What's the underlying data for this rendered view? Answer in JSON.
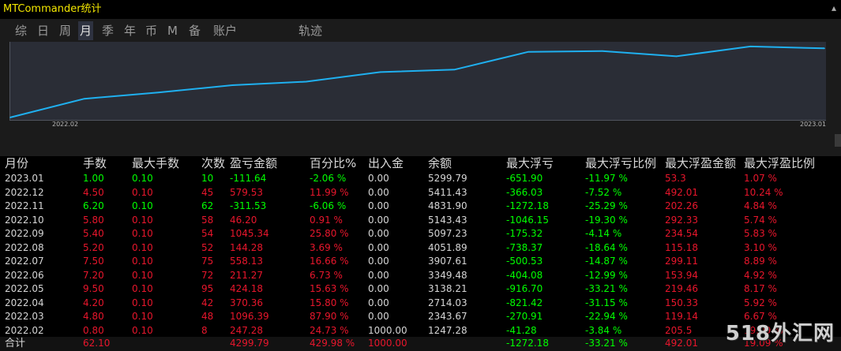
{
  "app": {
    "title": "MTCommander统计"
  },
  "tabs": [
    {
      "label": "综"
    },
    {
      "label": "日"
    },
    {
      "label": "周"
    },
    {
      "label": "月"
    },
    {
      "label": "季"
    },
    {
      "label": "年"
    },
    {
      "label": "币"
    },
    {
      "label": "M"
    },
    {
      "label": "备"
    },
    {
      "label": "账户"
    },
    {
      "label": "轨迹"
    }
  ],
  "active_tab": "月",
  "chart_data": {
    "type": "line",
    "x": [
      "2022.02",
      "2022.03",
      "2022.04",
      "2022.05",
      "2022.06",
      "2022.07",
      "2022.08",
      "2022.09",
      "2022.10",
      "2022.11",
      "2022.12",
      "2023.01"
    ],
    "series": [
      {
        "values": [
          1247.28,
          2343.67,
          2714.03,
          3138.21,
          3349.48,
          3907.61,
          4051.89,
          5097.23,
          5143.43,
          4831.9,
          5411.43,
          5299.79
        ]
      }
    ],
    "x_tick_labels": [
      "2022.02",
      "2023.01"
    ],
    "ylim": [
      1150,
      5500
    ],
    "line_color": "#1fb0f0",
    "grid": false
  },
  "table": {
    "headers": [
      "月份",
      "手数",
      "最大手数",
      "次数",
      "盈亏金额",
      "百分比%",
      "出入金",
      "余额",
      "最大浮亏",
      "最大浮亏比例",
      "最大浮盈金额",
      "最大浮盈比例"
    ],
    "rows": [
      {
        "month": "2023.01",
        "lots": "1.00",
        "max_lots": "0.10",
        "count": "10",
        "pnl": "-111.64",
        "pct": "-2.06 %",
        "io": "0.00",
        "balance": "5299.79",
        "max_dd": "-651.90",
        "max_dd_pct": "-11.97 %",
        "max_fp": "53.3",
        "max_fp_pct": "1.07 %",
        "sign": "g"
      },
      {
        "month": "2022.12",
        "lots": "4.50",
        "max_lots": "0.10",
        "count": "45",
        "pnl": "579.53",
        "pct": "11.99 %",
        "io": "0.00",
        "balance": "5411.43",
        "max_dd": "-366.03",
        "max_dd_pct": "-7.52 %",
        "max_fp": "492.01",
        "max_fp_pct": "10.24 %",
        "sign": "r"
      },
      {
        "month": "2022.11",
        "lots": "6.20",
        "max_lots": "0.10",
        "count": "62",
        "pnl": "-311.53",
        "pct": "-6.06 %",
        "io": "0.00",
        "balance": "4831.90",
        "max_dd": "-1272.18",
        "max_dd_pct": "-25.29 %",
        "max_fp": "202.26",
        "max_fp_pct": "4.84 %",
        "sign": "g"
      },
      {
        "month": "2022.10",
        "lots": "5.80",
        "max_lots": "0.10",
        "count": "58",
        "pnl": "46.20",
        "pct": "0.91 %",
        "io": "0.00",
        "balance": "5143.43",
        "max_dd": "-1046.15",
        "max_dd_pct": "-19.30 %",
        "max_fp": "292.33",
        "max_fp_pct": "5.74 %",
        "sign": "r"
      },
      {
        "month": "2022.09",
        "lots": "5.40",
        "max_lots": "0.10",
        "count": "54",
        "pnl": "1045.34",
        "pct": "25.80 %",
        "io": "0.00",
        "balance": "5097.23",
        "max_dd": "-175.32",
        "max_dd_pct": "-4.14 %",
        "max_fp": "234.54",
        "max_fp_pct": "5.83 %",
        "sign": "r"
      },
      {
        "month": "2022.08",
        "lots": "5.20",
        "max_lots": "0.10",
        "count": "52",
        "pnl": "144.28",
        "pct": "3.69 %",
        "io": "0.00",
        "balance": "4051.89",
        "max_dd": "-738.37",
        "max_dd_pct": "-18.64 %",
        "max_fp": "115.18",
        "max_fp_pct": "3.10 %",
        "sign": "r"
      },
      {
        "month": "2022.07",
        "lots": "7.50",
        "max_lots": "0.10",
        "count": "75",
        "pnl": "558.13",
        "pct": "16.66 %",
        "io": "0.00",
        "balance": "3907.61",
        "max_dd": "-500.53",
        "max_dd_pct": "-14.87 %",
        "max_fp": "299.11",
        "max_fp_pct": "8.89 %",
        "sign": "r"
      },
      {
        "month": "2022.06",
        "lots": "7.20",
        "max_lots": "0.10",
        "count": "72",
        "pnl": "211.27",
        "pct": "6.73 %",
        "io": "0.00",
        "balance": "3349.48",
        "max_dd": "-404.08",
        "max_dd_pct": "-12.99 %",
        "max_fp": "153.94",
        "max_fp_pct": "4.92 %",
        "sign": "r"
      },
      {
        "month": "2022.05",
        "lots": "9.50",
        "max_lots": "0.10",
        "count": "95",
        "pnl": "424.18",
        "pct": "15.63 %",
        "io": "0.00",
        "balance": "3138.21",
        "max_dd": "-916.70",
        "max_dd_pct": "-33.21 %",
        "max_fp": "219.46",
        "max_fp_pct": "8.17 %",
        "sign": "r"
      },
      {
        "month": "2022.04",
        "lots": "4.20",
        "max_lots": "0.10",
        "count": "42",
        "pnl": "370.36",
        "pct": "15.80 %",
        "io": "0.00",
        "balance": "2714.03",
        "max_dd": "-821.42",
        "max_dd_pct": "-31.15 %",
        "max_fp": "150.33",
        "max_fp_pct": "5.92 %",
        "sign": "r"
      },
      {
        "month": "2022.03",
        "lots": "4.80",
        "max_lots": "0.10",
        "count": "48",
        "pnl": "1096.39",
        "pct": "87.90 %",
        "io": "0.00",
        "balance": "2343.67",
        "max_dd": "-270.91",
        "max_dd_pct": "-22.94 %",
        "max_fp": "119.14",
        "max_fp_pct": "6.67 %",
        "sign": "r"
      },
      {
        "month": "2022.02",
        "lots": "0.80",
        "max_lots": "0.10",
        "count": "8",
        "pnl": "247.28",
        "pct": "24.73 %",
        "io": "1000.00",
        "balance": "1247.28",
        "max_dd": "-41.28",
        "max_dd_pct": "-3.84 %",
        "max_fp": "205.5",
        "max_fp_pct": "19.09 %",
        "sign": "r"
      }
    ],
    "total": {
      "label": "合计",
      "lots": "62.10",
      "pnl": "4299.79",
      "pct": "429.98 %",
      "io": "1000.00",
      "max_dd": "-1272.18",
      "max_dd_pct": "-33.21 %",
      "max_fp": "492.01",
      "max_fp_pct": "19.09 %"
    }
  },
  "watermark": "518外汇网",
  "colors": {
    "title": "#f2e600",
    "positive": "#e8162c",
    "negative": "#00ff00",
    "line": "#1fb0f0"
  }
}
